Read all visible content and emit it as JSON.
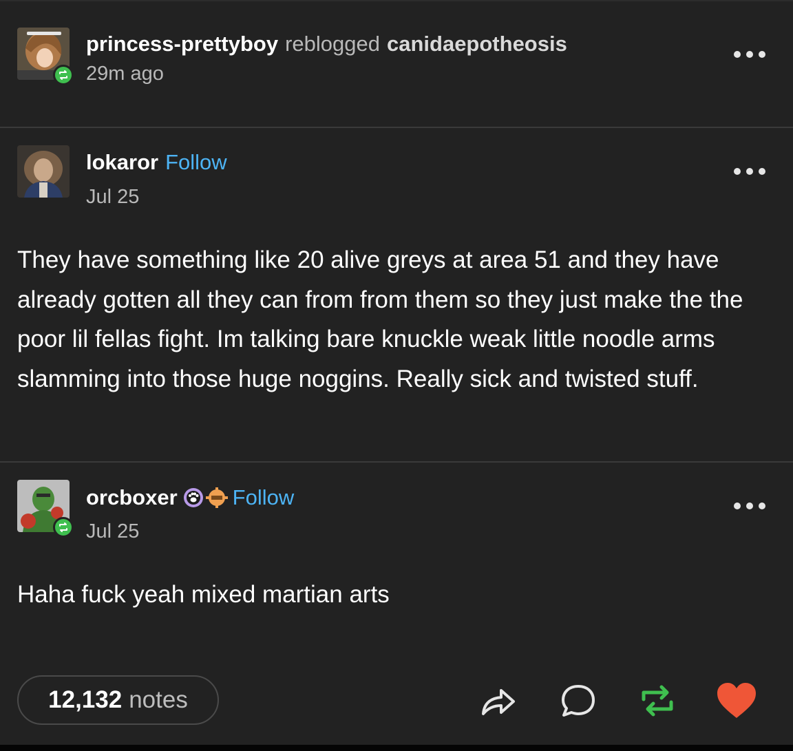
{
  "reblog_header": {
    "username": "princess-prettyboy",
    "action": "reblogged",
    "source": "canidaepotheosis",
    "time": "29m ago"
  },
  "post1": {
    "username": "lokaror",
    "follow": "Follow",
    "date": "Jul 25",
    "body": "They have something like 20 alive greys at area 51 and they have already gotten all they can from from them so they just make the the poor lil fellas fight. Im talking bare knuckle weak little noodle arms slamming into those huge noggins. Really sick and twisted stuff."
  },
  "post2": {
    "username": "orcboxer",
    "follow": "Follow",
    "date": "Jul 25",
    "body": "Haha fuck yeah mixed martian arts"
  },
  "footer": {
    "notes_count": "12,132",
    "notes_label": "notes"
  },
  "colors": {
    "background": "#222222",
    "follow": "#4db4f5",
    "reblog_green": "#3fbf4f",
    "heart_red": "#ef5637"
  },
  "icons": [
    "options-icon",
    "reblog-badge-icon",
    "share-icon",
    "reply-icon",
    "reblog-icon",
    "like-heart-icon",
    "paw-badge-icon",
    "gear-badge-icon"
  ]
}
